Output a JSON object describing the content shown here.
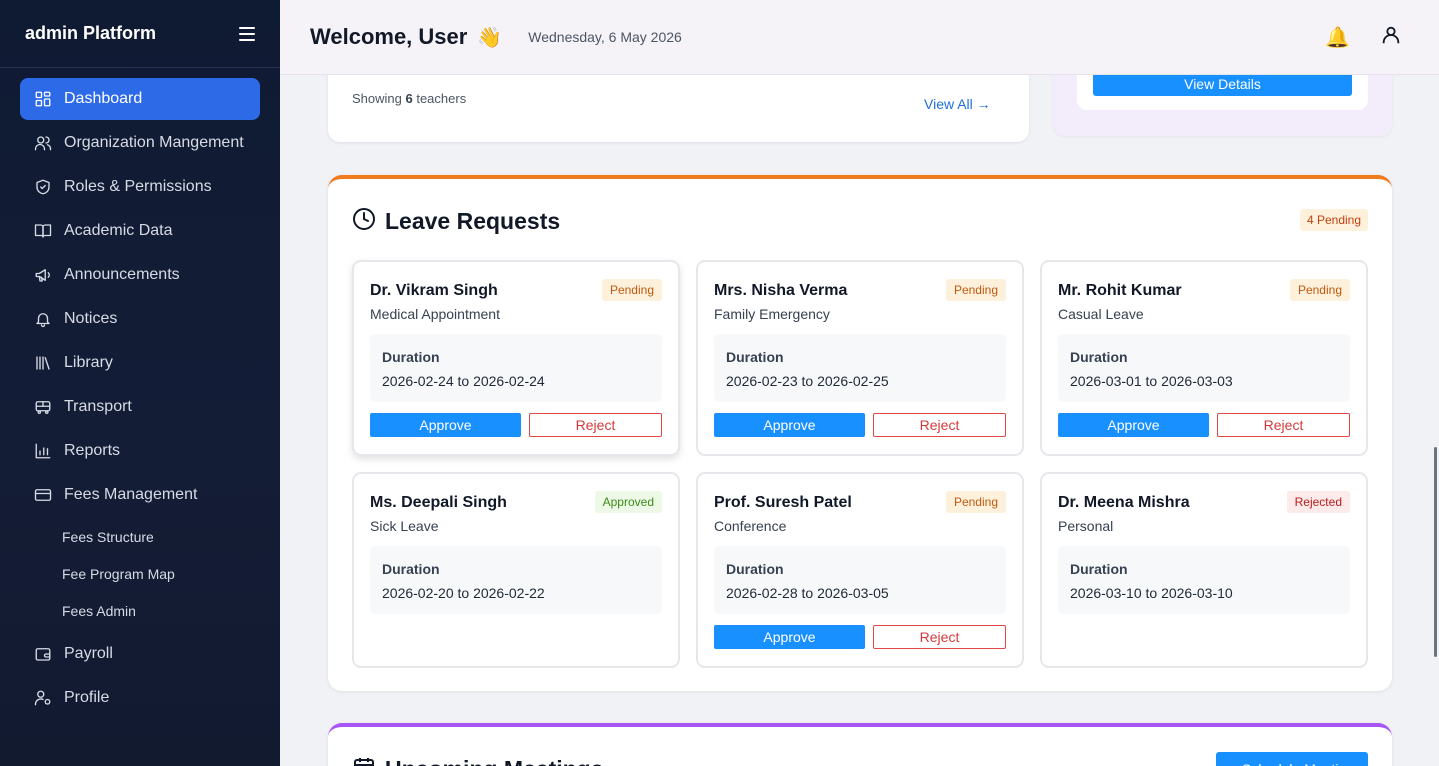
{
  "sidebar": {
    "brand": "admin Platform",
    "items": [
      {
        "label": "Dashboard",
        "icon": "grid-icon"
      },
      {
        "label": "Organization Mangement",
        "icon": "users-icon"
      },
      {
        "label": "Roles & Permissions",
        "icon": "shield-icon"
      },
      {
        "label": "Academic Data",
        "icon": "book-icon"
      },
      {
        "label": "Announcements",
        "icon": "megaphone-icon"
      },
      {
        "label": "Notices",
        "icon": "bell-icon"
      },
      {
        "label": "Library",
        "icon": "library-icon"
      },
      {
        "label": "Transport",
        "icon": "bus-icon"
      },
      {
        "label": "Reports",
        "icon": "chart-icon"
      },
      {
        "label": "Fees Management",
        "icon": "card-icon"
      },
      {
        "label": "Payroll",
        "icon": "wallet-icon"
      },
      {
        "label": "Profile",
        "icon": "user-cog-icon"
      }
    ],
    "fees_sub": [
      "Fees Structure",
      "Fee Program Map",
      "Fees Admin"
    ]
  },
  "header": {
    "welcome": "Welcome, User",
    "wave": "👋",
    "date": "Wednesday, 6 May 2026"
  },
  "teachers": {
    "showing_prefix": "Showing ",
    "count": "6",
    "showing_suffix": " teachers",
    "view_all": "View All →"
  },
  "summary_card": {
    "view_details": "View Details"
  },
  "leave": {
    "title": "Leave Requests",
    "pending_count": "4 Pending",
    "duration_label": "Duration",
    "approve_label": "Approve",
    "reject_label": "Reject",
    "requests": [
      {
        "name": "Dr. Vikram Singh",
        "type": "Medical Appointment",
        "status": "Pending",
        "duration": "2026-02-24 to 2026-02-24"
      },
      {
        "name": "Mrs. Nisha Verma",
        "type": "Family Emergency",
        "status": "Pending",
        "duration": "2026-02-23 to 2026-02-25"
      },
      {
        "name": "Mr. Rohit Kumar",
        "type": "Casual Leave",
        "status": "Pending",
        "duration": "2026-03-01 to 2026-03-03"
      },
      {
        "name": "Ms. Deepali Singh",
        "type": "Sick Leave",
        "status": "Approved",
        "duration": "2026-02-20 to 2026-02-22"
      },
      {
        "name": "Prof. Suresh Patel",
        "type": "Conference",
        "status": "Pending",
        "duration": "2026-02-28 to 2026-03-05"
      },
      {
        "name": "Dr. Meena Mishra",
        "type": "Personal",
        "status": "Rejected",
        "duration": "2026-03-10 to 2026-03-10"
      }
    ]
  },
  "meetings": {
    "title": "Upcoming Meetings",
    "schedule_label": "+ Schedule Meeting"
  },
  "colors": {
    "sidebar_bg": "#0f1a33",
    "active": "#2d6ae8",
    "primary": "#1890ff",
    "leave_accent": "#f07a1c",
    "meet_accent": "#a855f7"
  }
}
